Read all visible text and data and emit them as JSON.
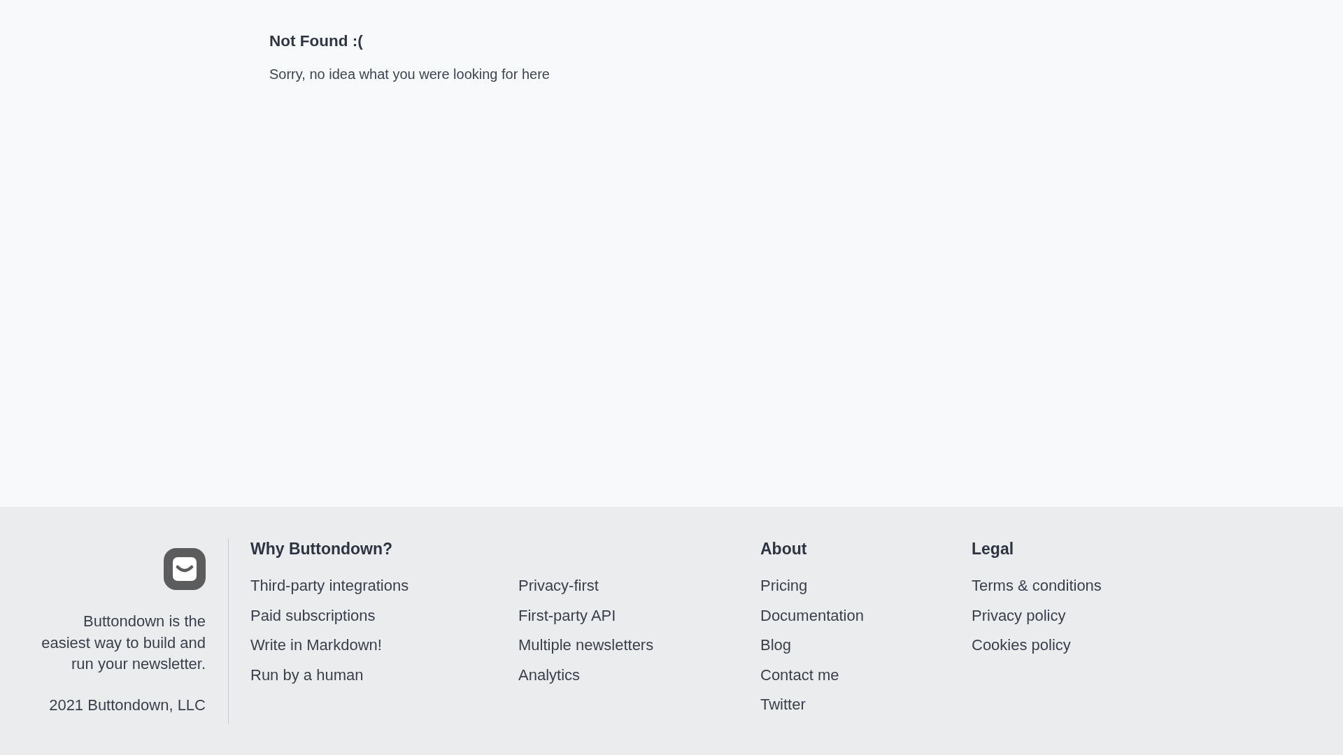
{
  "content": {
    "title": "Not Found :(",
    "message": "Sorry, no idea what you were looking for here"
  },
  "footer": {
    "description": "Buttondown is the easiest way to build and run your newsletter.",
    "copyright": "2021 Buttondown, LLC",
    "sections": [
      {
        "heading": "Why Buttondown?",
        "columns": [
          [
            "Third-party integrations",
            "Paid subscriptions",
            "Write in Markdown!",
            "Run by a human"
          ],
          [
            "Privacy-first",
            "First-party API",
            "Multiple newsletters",
            "Analytics"
          ]
        ]
      },
      {
        "heading": "About",
        "columns": [
          [
            "Pricing",
            "Documentation",
            "Blog",
            "Contact me",
            "Twitter"
          ]
        ]
      },
      {
        "heading": "Legal",
        "columns": [
          [
            "Terms & conditions",
            "Privacy policy",
            "Cookies policy"
          ]
        ]
      }
    ]
  }
}
